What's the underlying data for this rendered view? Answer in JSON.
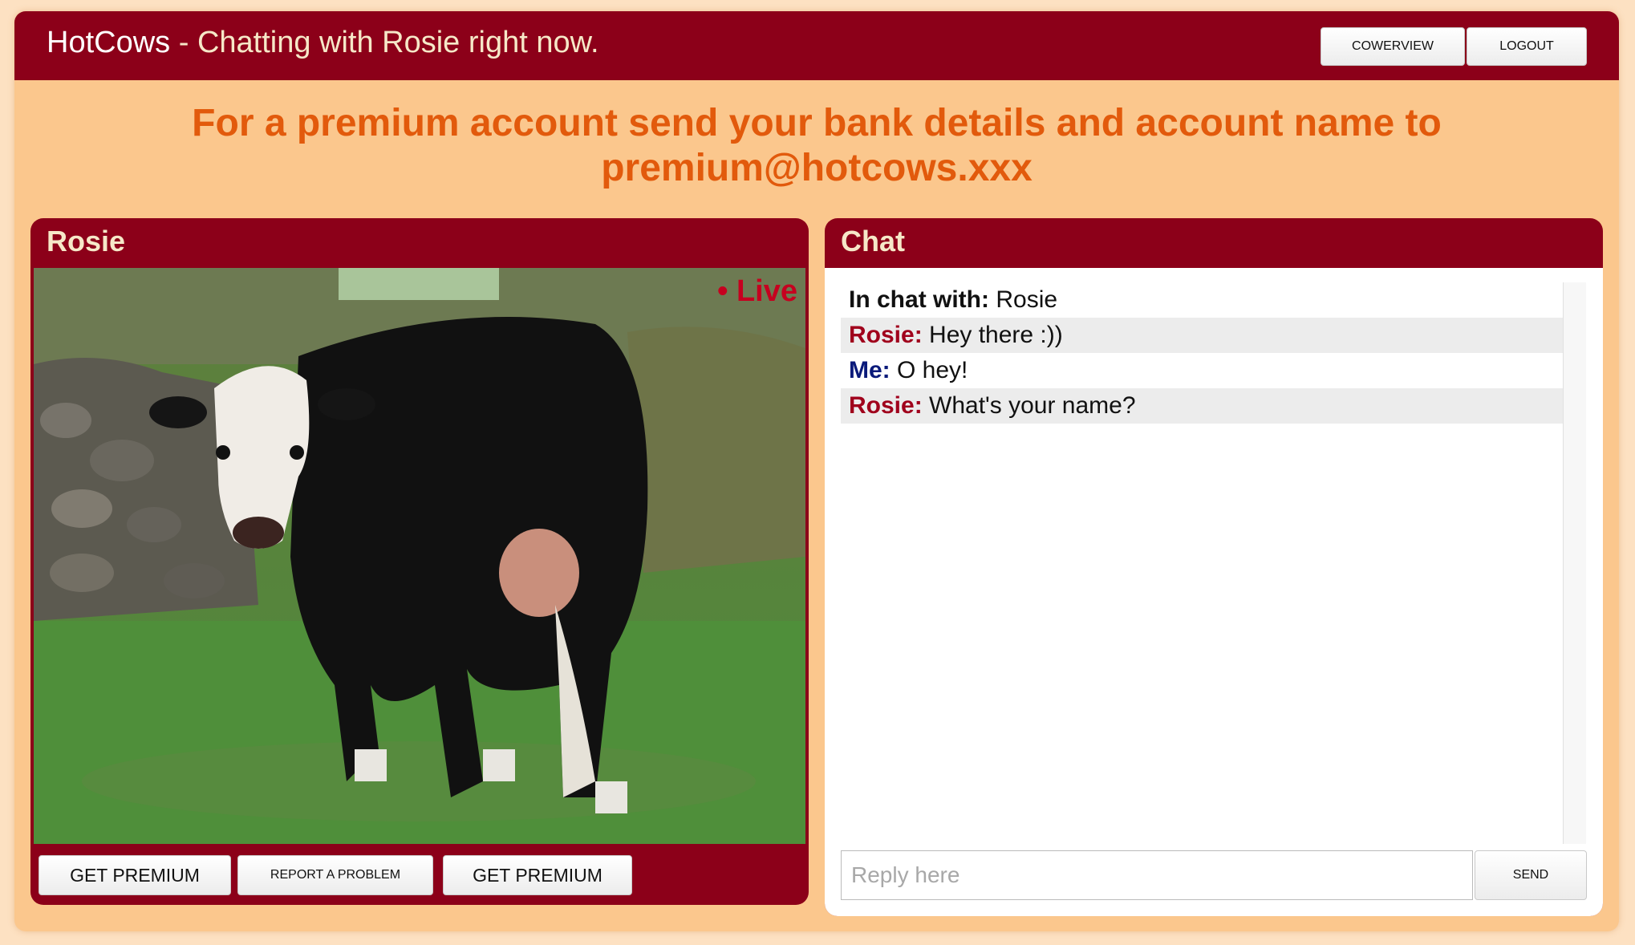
{
  "header": {
    "brand": "HotCows",
    "separator": "-",
    "subtitle": "Chatting with Rosie right now.",
    "buttons": [
      "COWERVIEW",
      "LOGOUT"
    ]
  },
  "promo": {
    "line1": "For a premium account send your bank details and account name to",
    "line2": "premium@hotcows.xxx"
  },
  "video_panel": {
    "title": "Rosie",
    "live_label": "• Live",
    "buttons": [
      "GET PREMIUM",
      "REPORT A PROBLEM",
      "GET PREMIUM"
    ]
  },
  "chat_panel": {
    "title": "Chat",
    "in_chat_label": "In chat with:",
    "in_chat_name": "Rosie",
    "messages": [
      {
        "sender": "Rosie:",
        "text": "Hey there :))"
      },
      {
        "sender": "Me:",
        "text": "O hey!"
      },
      {
        "sender": "Rosie:",
        "text": "What's your name?"
      }
    ],
    "reply_placeholder": "Reply here",
    "send_label": "SEND"
  },
  "colors": {
    "brand_red": "#8c0019",
    "accent_orange": "#e25a0c",
    "page_bg": "#fbc78d",
    "rosie_name": "#a0001c",
    "me_name": "#0a1a7a"
  }
}
